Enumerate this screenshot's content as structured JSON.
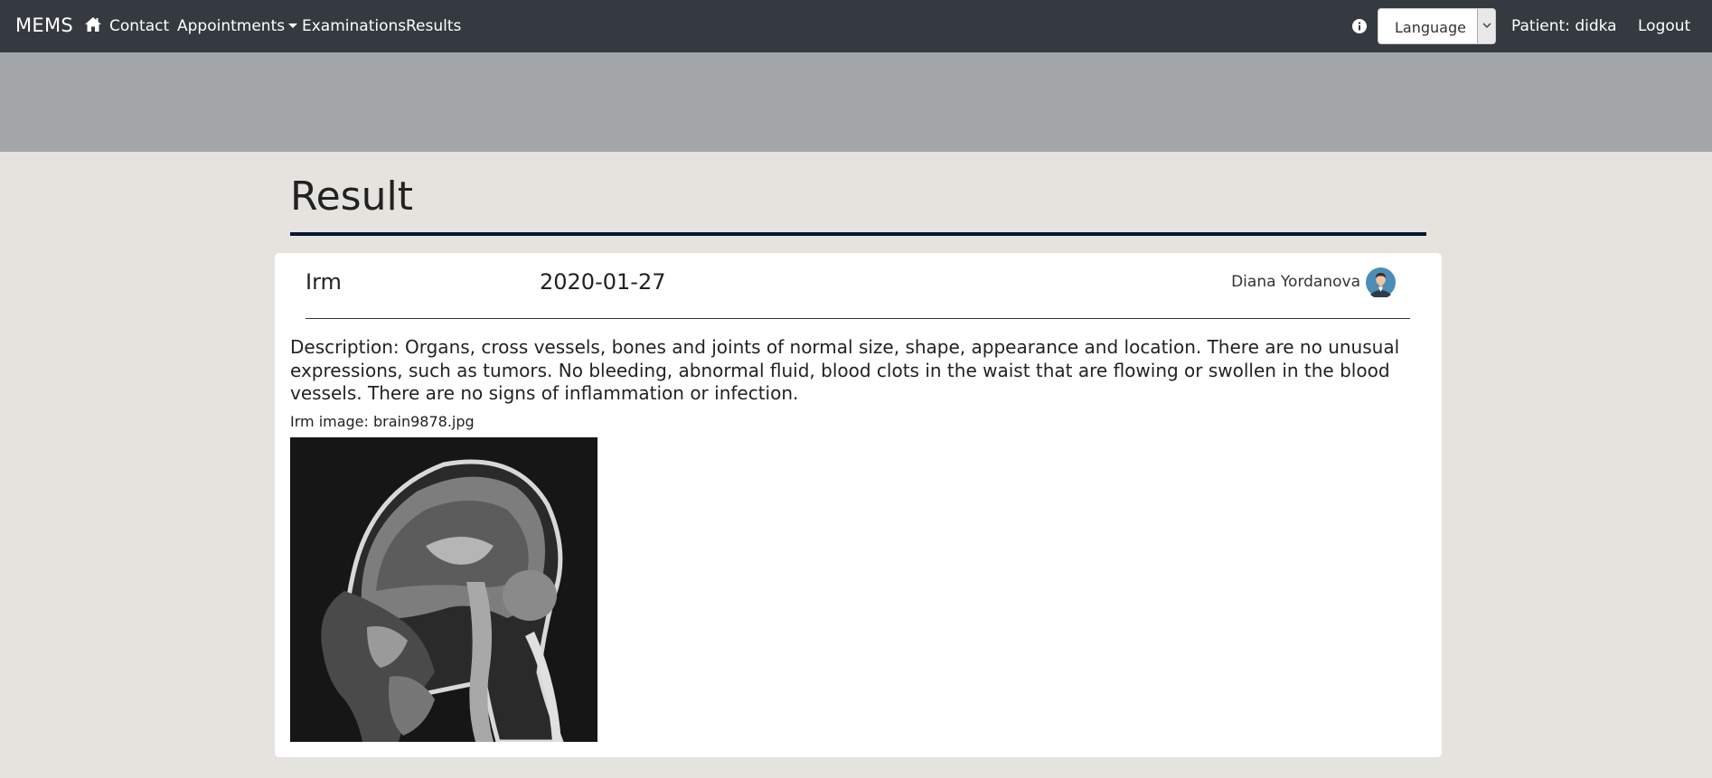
{
  "navbar": {
    "brand": "MEMS",
    "links": {
      "contact": "Contact",
      "appointments": "Appointments",
      "examinations": "Examinations",
      "results": "Results"
    },
    "language_select": {
      "selected": "Language"
    },
    "patient": "Patient: didka",
    "logout": "Logout"
  },
  "page": {
    "title": "Result"
  },
  "result": {
    "type": "Irm",
    "date": "2020-01-27",
    "doctor": "Diana Yordanova",
    "description": "Description: Organs, cross vessels, bones and joints of normal size, shape, appearance and location. There are no unusual expressions, such as tumors. No bleeding, abnormal fluid, blood clots in the waist that are flowing or swollen in the blood vessels. There are no signs of inflammation or infection.",
    "image_caption": "Irm image: brain9878.jpg"
  },
  "colors": {
    "navbar_bg": "#343a40",
    "banner_bg": "#a2a6a9",
    "page_bg": "#e4e3de",
    "title_rule": "#0b1532"
  }
}
